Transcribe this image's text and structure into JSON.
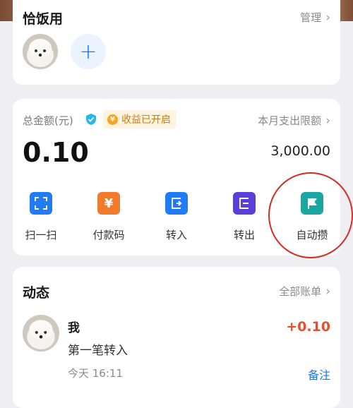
{
  "group": {
    "title": "恰饭用",
    "manage_label": "管理"
  },
  "balance": {
    "label": "总金额(元)",
    "yield_status": "收益已开启",
    "limit_label": "本月支出限额",
    "amount": "0.10",
    "limit_value": "3,000.00"
  },
  "actions": [
    {
      "label": "扫一扫",
      "icon": "scan-icon",
      "color": "#1f7cf5"
    },
    {
      "label": "付款码",
      "icon": "yuan-icon",
      "color": "#f07b2a"
    },
    {
      "label": "转入",
      "icon": "transfer-in-icon",
      "color": "#1f7cf5"
    },
    {
      "label": "转出",
      "icon": "transfer-out-icon",
      "color": "#5a3fd6"
    },
    {
      "label": "自动攒",
      "icon": "flag-icon",
      "color": "#1ba6a1"
    }
  ],
  "activity": {
    "title": "动态",
    "all_bills_label": "全部账单",
    "items": [
      {
        "name": "我",
        "description": "第一笔转入",
        "time": "今天 16:11",
        "amount": "+0.10",
        "note_label": "备注"
      }
    ]
  },
  "colors": {
    "accent": "#1677ff",
    "highlight_ring": "#d62b23",
    "income": "#e2502d"
  }
}
